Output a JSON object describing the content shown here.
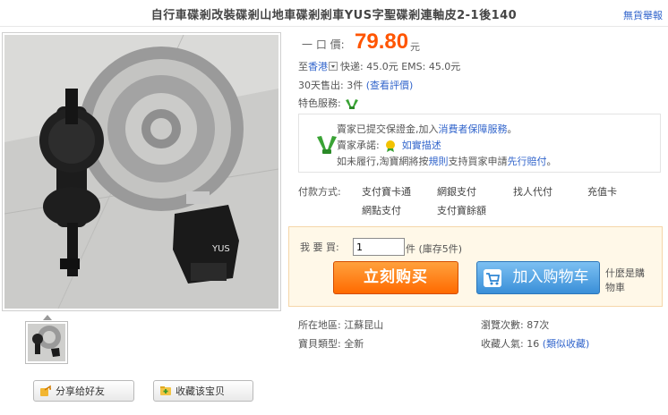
{
  "header": {
    "title": "自行車碟剎改裝碟剎山地車碟剎剎車YUS字聖碟剎連軸皮2-1後140",
    "report_link": "無貨舉報"
  },
  "price": {
    "label": "一 口 價:",
    "value": "79.80",
    "unit": "元"
  },
  "shipping": {
    "destination_prefix": "至",
    "destination": "香港",
    "fees": "快递: 45.0元   EMS: 45.0元"
  },
  "sales": {
    "text": "30天售出: 3件",
    "review_link": "(查看評價)"
  },
  "services": {
    "label": "特色服務:"
  },
  "guarantee": {
    "line1_prefix": "賣家已提交保證金,加入",
    "line1_link": "消費者保障服務",
    "line1_suffix": "。",
    "line2_prefix": "賣家承諾:",
    "line2_link": "如實描述",
    "line3_prefix": "如未履行,淘寶網將按",
    "line3_link1": "規則",
    "line3_mid": "支持買家申請",
    "line3_link2": "先行賠付",
    "line3_suffix": "。"
  },
  "payment": {
    "label": "付款方式:",
    "methods": [
      "支付寶卡通",
      "網銀支付",
      "找人代付",
      "充值卡",
      "網點支付",
      "支付寶餘額"
    ]
  },
  "purchase": {
    "qty_label": "我 要 買:",
    "qty_value": "1",
    "stock_text": "件 (庫存5件)",
    "buy_now_label": "立刻购买",
    "add_cart_label": "加入购物车",
    "what_is_cart": "什麼是購物車"
  },
  "details": {
    "location_label": "所在地區:",
    "location": "江蘇昆山",
    "views_label": "瀏覽次數:",
    "views": "87次",
    "type_label": "寶貝類型:",
    "type": "全新",
    "favorites_label": "收藏人氣:",
    "favorites": "16",
    "similar_link": "(類似收藏)"
  },
  "share": {
    "share_label": "分享给好友",
    "collect_label": "收藏该宝贝"
  },
  "colors": {
    "price": "#ff5500",
    "link": "#3366cc",
    "buy_now": "#ff6a00",
    "add_cart": "#3a8fd8"
  },
  "icons": {
    "services": "thumbs-up-hands-icon",
    "promise": "badge-icon",
    "share": "share-icon",
    "collect": "folder-add-icon",
    "cart": "cart-icon"
  }
}
